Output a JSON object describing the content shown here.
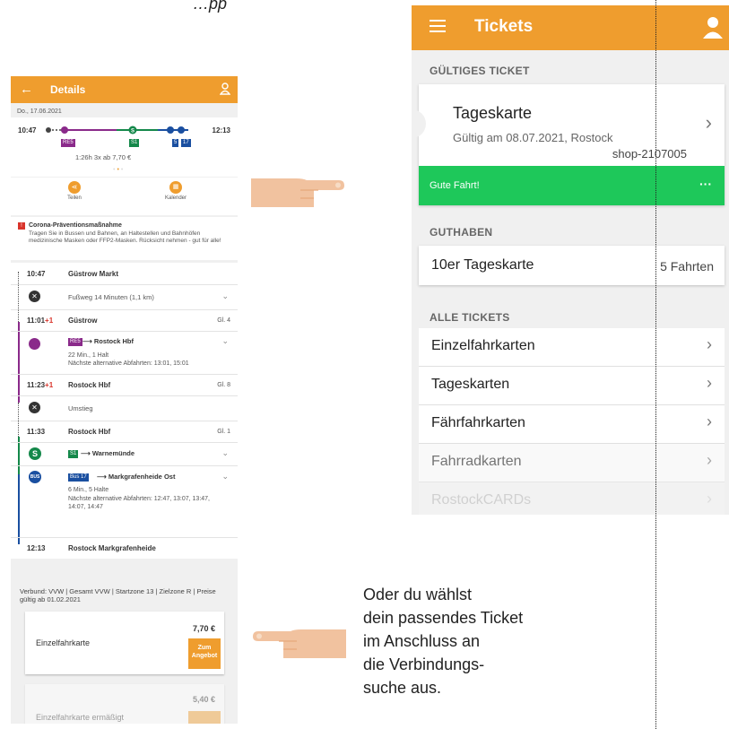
{
  "top_caption_fragment": "…pp",
  "left_phone": {
    "title": "Details",
    "date": "Do., 17.06.2021",
    "depart_time": "10:47",
    "arrive_time": "12:13",
    "tag_re5": "RE5",
    "tag_s1": "S1",
    "tag_5": "5",
    "tag_17": "17",
    "summary": "1:26h   3x   ab 7,70 €",
    "share_label": "Teilen",
    "calendar_label": "Kalender",
    "notice_title": "Corona-Präventionsmaßnahme",
    "notice_text": "Tragen Sie in Bussen und Bahnen, an Haltestellen und Bahnhöfen medizinische Masken oder FFP2-Masken. Rücksicht nehmen - gut für alle!",
    "stops": [
      {
        "time": "10:47",
        "name": "Güstrow Markt",
        "track": ""
      },
      {
        "time": "11:01",
        "delay": "+1",
        "name": "Güstrow",
        "track": "Gl. 4"
      },
      {
        "time": "11:23",
        "delay": "+1",
        "name": "Rostock Hbf",
        "track": "Gl. 8"
      },
      {
        "time": "11:33",
        "name": "Rostock Hbf",
        "track": "Gl. 1"
      },
      {
        "time": "12:13",
        "name": "Rostock Markgrafenheide",
        "track": ""
      }
    ],
    "walk1": "Fußweg 14 Minuten (1,1 km)",
    "re5_line": "RE5",
    "re5_dest": "⟶ Rostock Hbf",
    "re5_info1": "22 Min., 1 Halt",
    "re5_info2": "Nächste alternative Abfahrten: 13:01, 15:01",
    "transfer": "Umstieg",
    "s1_line": "S1",
    "s1_dest": "⟶ Warnemünde",
    "bus_icon": "BUS",
    "bus_line": "Bus 17",
    "bus_dest": "⟶ Markgrafenheide Ost",
    "bus_info1": "6 Min., 5 Halte",
    "bus_info2": "Nächste alternative Abfahrten: 12:47, 13:07, 13:47, 14:07, 14:47",
    "tariff": "Verbund: VVW | Gesamt VVW | Startzone 13 | Zielzone R | Preise gültig ab 01.02.2021",
    "price1_name": "Einzelfahrkarte",
    "price1_value": "7,70 €",
    "price_button": "Zum Angebot",
    "price2_name": "Einzelfahrkarte ermäßigt",
    "price2_value": "5,40 €"
  },
  "right_phone": {
    "title": "Tickets",
    "section_valid": "GÜLTIGES TICKET",
    "ticket_name": "Tageskarte",
    "ticket_valid": "Gültig am 08.07.2021, Rostock",
    "ticket_code": "shop-2107005",
    "ticket_status": "Gute Fahrt!",
    "ticket_more": "···",
    "section_credit": "GUTHABEN",
    "credit_name": "10er Tageskarte",
    "credit_value": "5 Fahrten",
    "section_all": "ALLE TICKETS",
    "all_tickets": [
      "Einzelfahrkarten",
      "Tageskarten",
      "Fährfahrkarten",
      "Fahrradkarten",
      "RostockCARDs"
    ]
  },
  "bottom_caption": [
    "Oder du wählst",
    "dein passendes Ticket",
    "im Anschluss an",
    "die Verbindungs-",
    "suche aus."
  ],
  "colors": {
    "accent": "#ef9d2e",
    "green": "#1ec85a",
    "purple": "#8a2a8a",
    "sbahn": "#14884a",
    "bus": "#1a4fa0"
  }
}
